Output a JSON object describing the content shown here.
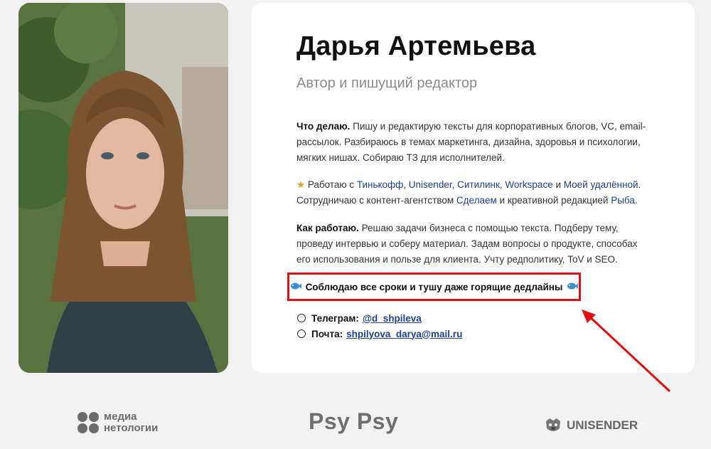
{
  "profile": {
    "name": "Дарья Артемьева",
    "role": "Автор и пишущий редактор"
  },
  "about": {
    "what_title": "Что делаю.",
    "what_text": " Пишу и редактирую тексты для корпоративных блогов, VC, email-рассылок. Разбираюсь в темах маркетинга, дизайна, здоровья и психологии, мягких нишах. Собираю ТЗ для исполнителей.",
    "work_prefix": "Работаю с ",
    "companies": [
      "Тинькофф",
      "Unisender",
      "Ситилинк",
      "Workspace",
      "Моей удалённой"
    ],
    "sep_comma": ", ",
    "sep_and": " и ",
    "work_end": ".",
    "collab_prefix": "Сотрудничаю с контент-агентством ",
    "agency": "Сделаем",
    "collab_mid": " и креативной редакцией ",
    "editorial": "Рыба",
    "collab_end": ".",
    "how_title": "Как работаю.",
    "how_text": " Решаю задачи бизнеса с помощью текста. Подберу тему, проведу интервью и соберу материал. Задам вопросы о продукте, способах его использования и пользе для клиента. Учту редполитику, ToV и SEO."
  },
  "highlight": {
    "text": "Соблюдаю все сроки и тушу даже горящие дедлайны"
  },
  "contacts": {
    "telegram_label": "Телеграм:",
    "telegram_value": "@d_shpileva",
    "email_label": "Почта:",
    "email_value": "shpilyova_darya@mail.ru"
  },
  "logos": {
    "media_line1": "медиа",
    "media_line2": "нетологии",
    "psy": "Psy Psy",
    "unisender": "UNISENDER"
  },
  "colors": {
    "link": "#1f3f8f",
    "highlight_border": "#e01010",
    "arrow": "#e01010"
  },
  "icons": [
    "star-icon",
    "fish-icon",
    "radio-icon",
    "arrow-icon",
    "dog-icon"
  ]
}
